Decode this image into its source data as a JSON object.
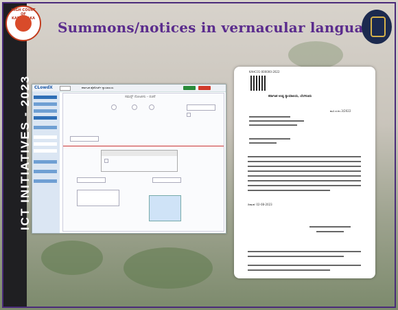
{
  "slide": {
    "title": "Summons/notices in vernacular language",
    "sidebar_label": "ICT INITIATIVES - 2023",
    "left_logo_caption": "HIGH COURT OF KARNATAKA"
  },
  "screenshot": {
    "app_logo": "CLowdX",
    "header_text": "ಕರ್ನಾಟಕ ಹೈಕೋರ್ಟ್ ನ್ಯಾಯಾಲಯ",
    "pane_title": "ಸಮನ್ಸ್ ನೋಟೀಸು - ರಚನೆ"
  },
  "document": {
    "ref_no": "KAHC01-000000-2022",
    "court_heading": "ಕರ್ನಾಟಕ ಉಚ್ಚ ನ್ಯಾಯಾಲಯ, ಬೆಂಗಳೂರು",
    "case_no": "ಮೂ.ಸ.ನಂ.3/2022",
    "date_line": "ದಿನಾಂಕ: 02-08-2023"
  }
}
